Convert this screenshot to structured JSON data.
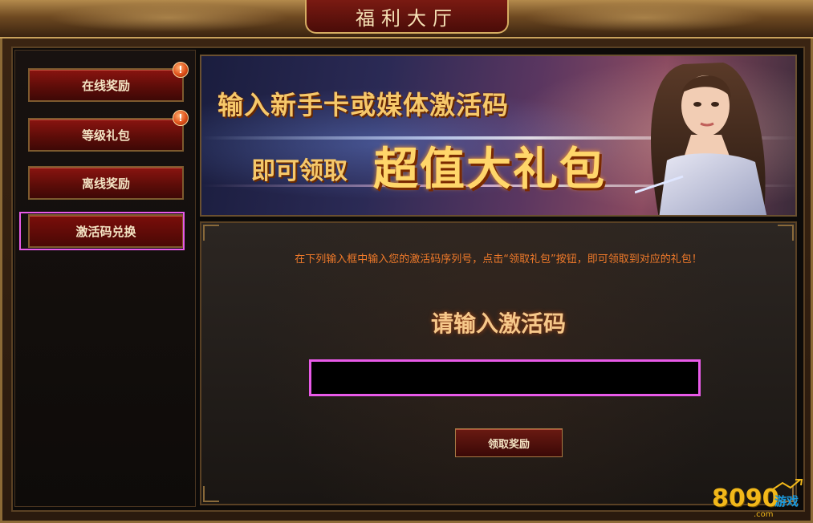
{
  "header": {
    "title": "福利大厅"
  },
  "sidebar": {
    "items": [
      {
        "label": "在线奖励",
        "badge": "!"
      },
      {
        "label": "等级礼包",
        "badge": "!"
      },
      {
        "label": "离线奖励"
      },
      {
        "label": "激活码兑换",
        "active": true
      }
    ]
  },
  "banner": {
    "line1": "输入新手卡或媒体激活码",
    "line2_prefix": "即可领取",
    "line2_highlight": "超值大礼包"
  },
  "main": {
    "instruction": "在下列输入框中输入您的激活码序列号，点击“领取礼包”按钮，即可领取到对应的礼包！",
    "prompt_label": "请输入激活码",
    "code_input": {
      "value": "",
      "placeholder": ""
    },
    "claim_button": "领取奖励"
  },
  "watermark": {
    "digits": "8090",
    "text": "游戏",
    "domain": ".com"
  },
  "colors": {
    "accent_gold": "#f6c86a",
    "button_red": "#8a1410",
    "instruction_orange": "#f07a2a",
    "highlight_magenta": "#e85ae8"
  }
}
